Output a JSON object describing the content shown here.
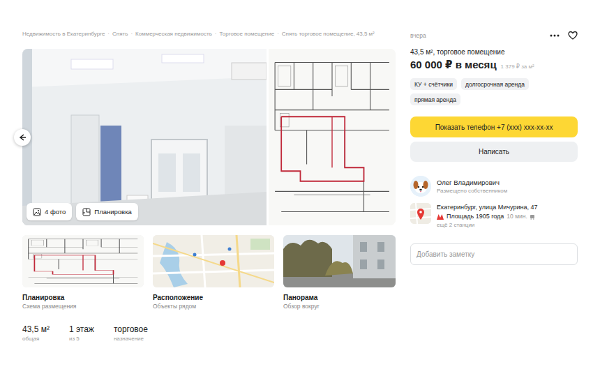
{
  "breadcrumbs": {
    "separator": "·",
    "items": [
      {
        "label": "Недвижимость в Екатеринбурге"
      },
      {
        "label": "Снять"
      },
      {
        "label": "Коммерческая недвижимость"
      },
      {
        "label": "Торговое помещение"
      },
      {
        "label": "Снять торговое помещение, 43,5 м²"
      }
    ]
  },
  "gallery": {
    "photos_button": "4 фото",
    "plan_button": "Планировка"
  },
  "thumbs": [
    {
      "title": "Планировка",
      "subtitle": "Схема размещения",
      "kind": "plan"
    },
    {
      "title": "Расположение",
      "subtitle": "Объекты рядом",
      "kind": "map"
    },
    {
      "title": "Панорама",
      "subtitle": "Обзор вокруг",
      "kind": "panorama"
    }
  ],
  "stats": [
    {
      "value": "43,5 м²",
      "label": "общая"
    },
    {
      "value": "1 этаж",
      "label": "из 5"
    },
    {
      "value": "торговое",
      "label": "назначение"
    }
  ],
  "listing": {
    "posted": "вчера",
    "favorite": false,
    "title": "43,5 м², торговое помещение",
    "price": "60 000 ₽ в месяц",
    "price_per_m2": "1 379 ₽ за м²"
  },
  "tags": [
    "КУ + счётчики",
    "долгосрочная аренда",
    "прямая аренда"
  ],
  "actions": {
    "phone": "Показать телефон +7 (ххх) ххх-хх-хх",
    "write": "Написать"
  },
  "seller": {
    "name": "Олег Владимирович",
    "note": "Размещено собственником"
  },
  "location": {
    "address": "Екатеринбург, улица Мичурина, 47",
    "metro": "Площадь 1905 года",
    "walk_time": "10 мин.",
    "more": "ещё 2 станции"
  },
  "note": {
    "placeholder": "Добавить заметку"
  }
}
